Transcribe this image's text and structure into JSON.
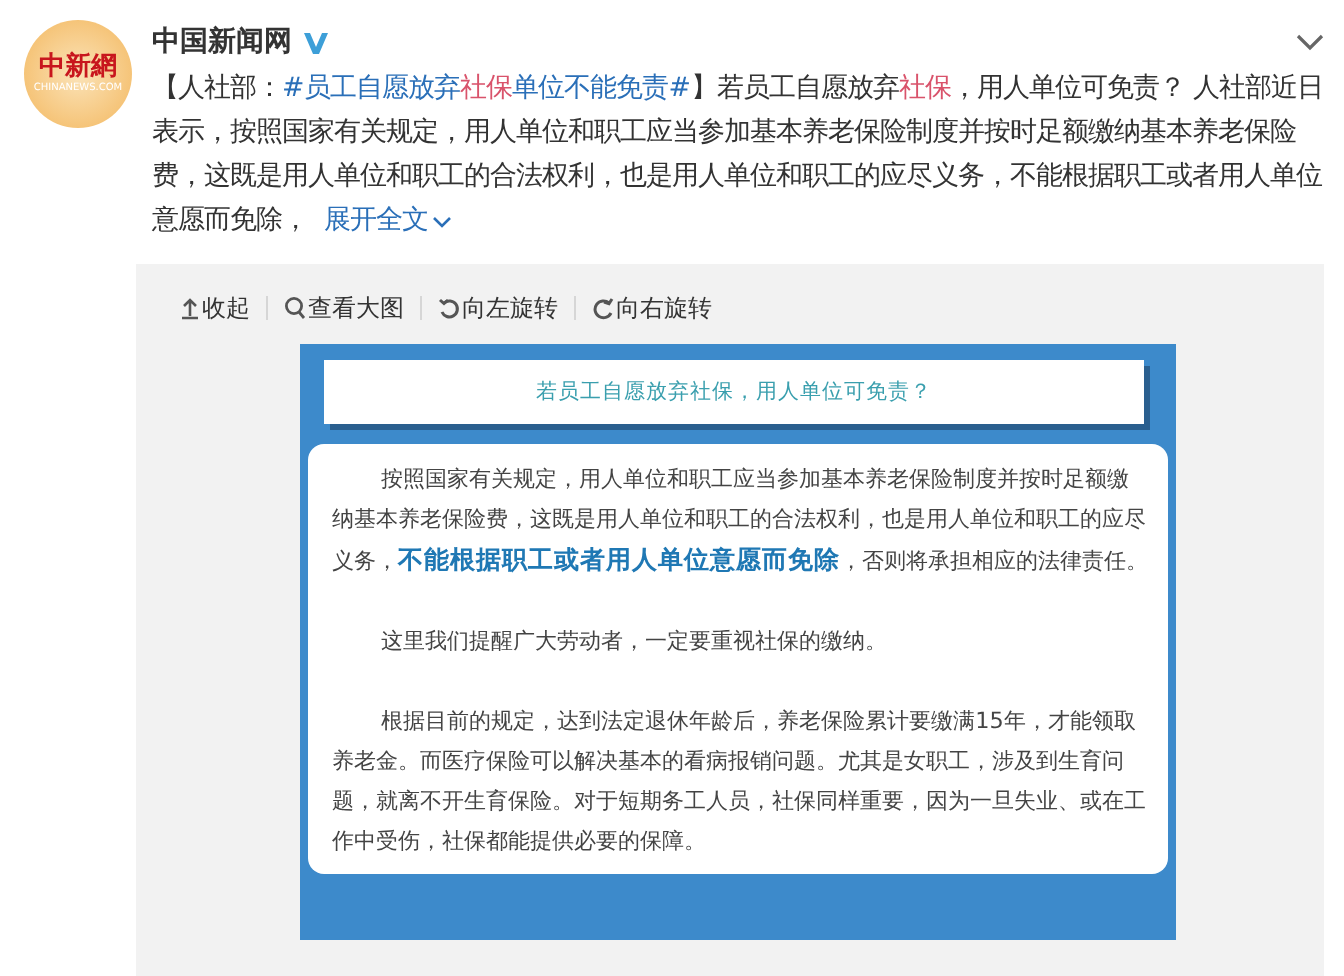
{
  "author": {
    "name": "中国新闻网",
    "verified": true,
    "avatar_text": "中新網",
    "avatar_subtext": "CHINANEWS.COM"
  },
  "post": {
    "segments": [
      {
        "kind": "text",
        "text": "【人社部："
      },
      {
        "kind": "topic",
        "text": "#员工自愿放弃"
      },
      {
        "kind": "keyword",
        "text": "社保"
      },
      {
        "kind": "topic",
        "text": "单位不能免责#"
      },
      {
        "kind": "text",
        "text": "】若员工自愿放弃"
      },
      {
        "kind": "keyword",
        "text": "社保"
      },
      {
        "kind": "text",
        "text": "，用人单位可免责？ 人社部近日表示，按照国家有关规定，用人单位和职工应当参加基本养老保险制度并按时足额缴纳基本养老保险费，这既是用人单位和职工的合法权利，也是用人单位和职工的应尽义务，不能根据职工或者用人单位意愿而免除，"
      }
    ],
    "expand": "展开全文"
  },
  "toolbar": [
    {
      "kind": "collapse",
      "label": "收起"
    },
    {
      "kind": "zoom",
      "label": "查看大图"
    },
    {
      "kind": "rotate-left",
      "label": "向左旋转"
    },
    {
      "kind": "rotate-right",
      "label": "向右旋转"
    }
  ],
  "image": {
    "title": "若员工自愿放弃社保，用人单位可免责？",
    "paragraphs": [
      "按照国家有关规定，用人单位和职工应当参加基本养老保险制度并按时足额缴纳基本养老保险费，这既是用人单位和职工的合法权利，也是用人单位和职工的应尽义务，**不能根据职工或者用人单位意愿而免除**，否则将承担相应的法律责任。",
      "这里我们提醒广大劳动者，一定要重视社保的缴纳。",
      "根据目前的规定，达到法定退休年龄后，养老保险累计要缴满15年，才能领取养老金。而医疗保险可以解决基本的看病报销问题。尤其是女职工，涉及到生育问题，就离不开生育保险。对于短期务工人员，社保同样重要，因为一旦失业、或在工作中受伤，社保都能提供必要的保障。"
    ]
  }
}
